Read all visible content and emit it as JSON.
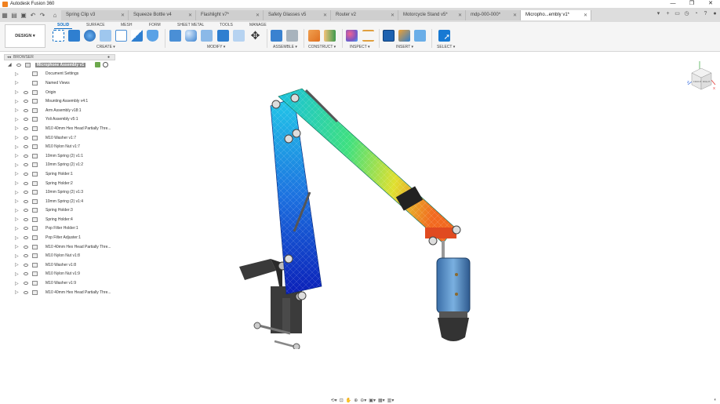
{
  "app_title": "Autodesk Fusion 360",
  "window_controls": {
    "minimize": "—",
    "restore": "❐",
    "close": "✕"
  },
  "doc_tabs": [
    {
      "label": "Spring Clip v3",
      "active": false
    },
    {
      "label": "Squeeze Bottle v4",
      "active": false
    },
    {
      "label": "Flashlight v7*",
      "active": false
    },
    {
      "label": "Safety Glasses v5",
      "active": false
    },
    {
      "label": "Router v2",
      "active": false
    },
    {
      "label": "Motorcycle Stand v5*",
      "active": false
    },
    {
      "label": "mdp-000-000*",
      "active": false
    },
    {
      "label": "Micropho...embly v1*",
      "active": true
    }
  ],
  "workspace": {
    "label": "DESIGN ▾"
  },
  "ribbon_tabs": [
    "SOLID",
    "SURFACE",
    "MESH",
    "FORM",
    "SHEET METAL",
    "TOOLS",
    "MANAGE"
  ],
  "ribbon_groups": [
    "CREATE ▾",
    "MODIFY ▾",
    "ASSEMBLE ▾",
    "CONSTRUCT ▾",
    "INSPECT ▾",
    "INSERT ▾",
    "SELECT ▾"
  ],
  "browser": {
    "title": "BROWSER",
    "root": "Microphone Assembly v1",
    "items": [
      "Document Settings",
      "Named Views",
      "Origin",
      "Mounting Assembly v4:1",
      "Arm Assembly v18:1",
      "Yoli Assembly v5:1",
      "M10 40mm Hex Head Partially Thre...",
      "M10 Washer v1:7",
      "M10 Nylon Nut v1:7",
      "10mm Spring (2) v1:1",
      "10mm Spring (2) v1:2",
      "Spring Holder:1",
      "Spring Holder:2",
      "10mm Spring (2) v1:3",
      "10mm Spring (2) v1:4",
      "Spring Holder:3",
      "Spring Holder:4",
      "Pop Filter Holder:1",
      "Pop Filter Adjuster:1",
      "M10 40mm Hex Head Partially Thre...",
      "M10 Nylon Nut v1:8",
      "M10 Washer v1:8",
      "M10 Nylon Nut v1:9",
      "M10 Washer v1:9",
      "M10 40mm Hex Head Partially Thre..."
    ]
  },
  "viewcube": {
    "front": "FRONT",
    "right": "RIGHT",
    "axis_z": "Z",
    "axis_x": "X"
  },
  "colors": {
    "accent": "#0b6cc5",
    "title_orange": "#f0801e"
  }
}
